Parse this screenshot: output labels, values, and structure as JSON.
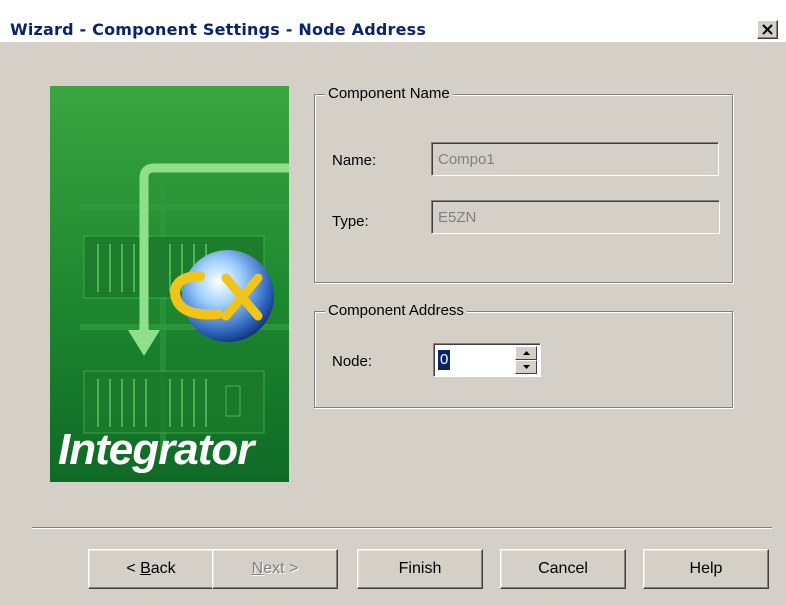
{
  "window": {
    "title": "Wizard - Component Settings - Node Address",
    "close_glyph": "✕"
  },
  "image": {
    "brand_text": "Integrator",
    "logo_text": "CX",
    "colors": {
      "green_dark": "#0f6a26",
      "green_mid": "#2a8f3a",
      "green_light": "#58c25e",
      "arrow": "#7fd37a",
      "text": "#ffffff"
    }
  },
  "component_name": {
    "legend": "Component Name",
    "name_label": "Name:",
    "name_value": "Compo1",
    "type_label": "Type:",
    "type_value": "E5ZN"
  },
  "component_address": {
    "legend": "Component Address",
    "node_label": "Node:",
    "node_value": "0"
  },
  "buttons": {
    "back": {
      "prefix": "< ",
      "mnemonic": "B",
      "rest": "ack",
      "enabled": true
    },
    "next": {
      "mnemonic": "N",
      "rest": "ext >",
      "enabled": false
    },
    "finish": "Finish",
    "cancel": "Cancel",
    "help": "Help"
  }
}
